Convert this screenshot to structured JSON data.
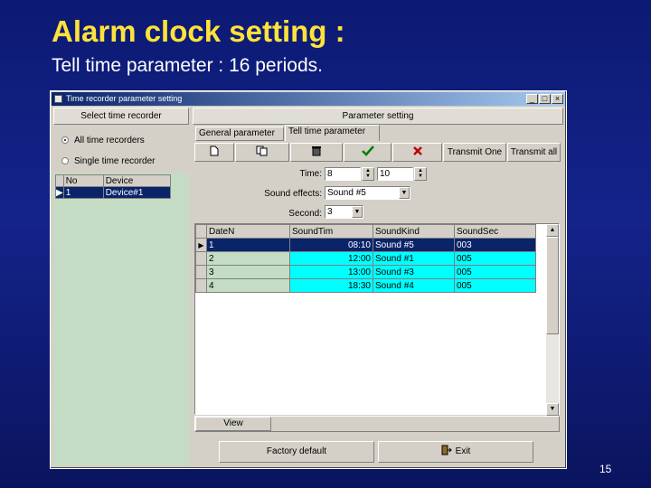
{
  "slide": {
    "title": "Alarm clock setting :",
    "subtitle": "Tell time parameter : 16 periods.",
    "page_number": "15"
  },
  "window": {
    "title": "Time recorder parameter setting",
    "controls": {
      "minimize": "_",
      "maximize": "□",
      "close": "×"
    }
  },
  "left_panel": {
    "header": "Select time recorder",
    "radios": [
      {
        "label": "All time recorders",
        "selected": true
      },
      {
        "label": "Single time recorder",
        "selected": false
      }
    ],
    "table": {
      "columns": [
        "No",
        "Device"
      ],
      "rows": [
        {
          "no": "1",
          "device": "Device#1"
        }
      ]
    }
  },
  "right_panel": {
    "header": "Parameter setting",
    "tabs": [
      {
        "label": "General parameter",
        "active": false
      },
      {
        "label": "Tell time parameter",
        "active": true
      }
    ],
    "toolbar": {
      "new_icon": "new-document-icon",
      "copy_icon": "copy-icon",
      "delete_icon": "trash-icon",
      "confirm_icon": "checkmark-icon",
      "cancel_icon": "cancel-x-icon",
      "transmit_one": "Transmit One",
      "transmit_all": "Transmit all",
      "check_color": "#008000",
      "cancel_color": "#c00000"
    },
    "form": {
      "time_label": "Time:",
      "time_start": "8",
      "time_end": "10",
      "sound_effects_label": "Sound effects:",
      "sound_effects_value": "Sound #5",
      "second_label": "Second:",
      "second_value": "3"
    },
    "grid": {
      "columns": [
        "DateN",
        "SoundTim",
        "SoundKind",
        "SoundSec"
      ],
      "rows": [
        {
          "date": "1",
          "time": "08:10",
          "kind": "Sound #5",
          "sec": "003",
          "selected": true
        },
        {
          "date": "2",
          "time": "12:00",
          "kind": "Sound #1",
          "sec": "005",
          "selected": false
        },
        {
          "date": "3",
          "time": "13:00",
          "kind": "Sound #3",
          "sec": "005",
          "selected": false
        },
        {
          "date": "4",
          "time": "18:30",
          "kind": "Sound #4",
          "sec": "005",
          "selected": false
        }
      ]
    },
    "view_label": "View",
    "factory_default": "Factory default",
    "exit": "Exit"
  },
  "colors": {
    "background": "#14238a",
    "title_color": "#ffe23a",
    "selected_row": "#0a246a",
    "grid_cyan": "#00ffff",
    "grid_green": "#c3dcc3"
  }
}
